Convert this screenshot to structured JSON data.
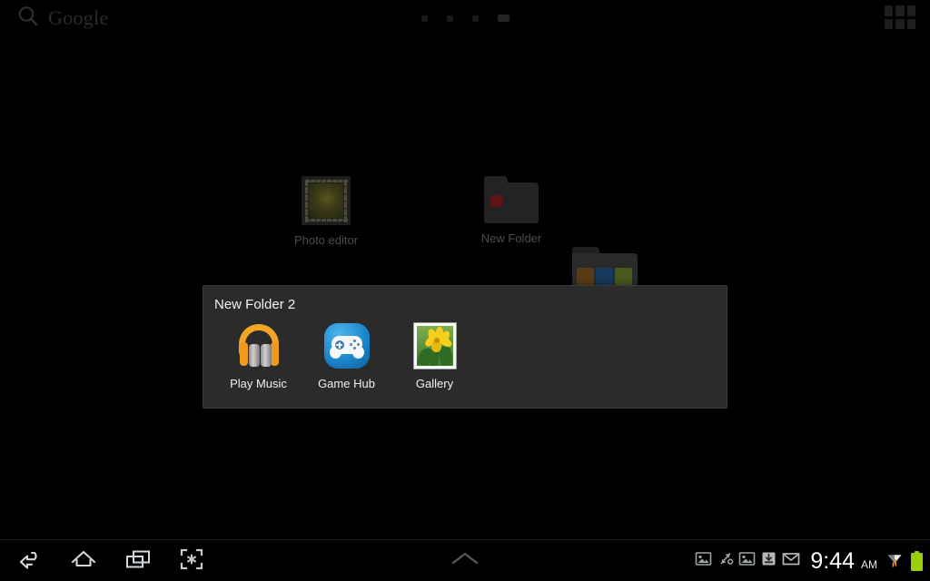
{
  "topbar": {
    "search": {
      "icon": "search-icon",
      "brand": "Google"
    },
    "page_indicator": {
      "count": 4,
      "active_index": 3
    },
    "apps_grid": {
      "icon": "apps-grid-icon",
      "label": "Apps"
    }
  },
  "home_icons": [
    {
      "name": "photo-editor",
      "label": "Photo editor",
      "icon": "photo-frame-icon"
    },
    {
      "name": "new-folder",
      "label": "New Folder",
      "icon": "folder-icon"
    },
    {
      "name": "new-folder-2",
      "label": "",
      "icon": "folder-icon"
    }
  ],
  "folder_dialog": {
    "title": "New Folder 2",
    "apps": [
      {
        "label": "Play Music",
        "icon": "headphones-icon",
        "color": "#f2a423"
      },
      {
        "label": "Game Hub",
        "icon": "game-controller-icon",
        "color": "#1d87cd"
      },
      {
        "label": "Gallery",
        "icon": "photo-flower-icon",
        "color": "#f5cf1b"
      }
    ]
  },
  "navbar": {
    "buttons": [
      {
        "name": "back",
        "icon": "back-arrow-icon"
      },
      {
        "name": "home",
        "icon": "home-icon"
      },
      {
        "name": "recents",
        "icon": "recent-apps-icon"
      },
      {
        "name": "screenshot",
        "icon": "screen-capture-icon"
      }
    ],
    "notification_handle": {
      "icon": "chevron-up-icon"
    }
  },
  "status_tray": {
    "icons": [
      {
        "name": "screenshot-captured",
        "icon": "image-icon"
      },
      {
        "name": "usb-transfer",
        "icon": "usb-transfer-icon"
      },
      {
        "name": "screenshot-saved",
        "icon": "image-icon"
      },
      {
        "name": "download-complete",
        "icon": "download-icon"
      },
      {
        "name": "new-email",
        "icon": "envelope-icon"
      }
    ],
    "clock": {
      "time": "9:44",
      "period": "AM"
    },
    "wifi": {
      "icon": "wifi-icon",
      "activity": true
    },
    "battery": {
      "icon": "battery-icon",
      "color": "#9acd0a"
    }
  },
  "colors": {
    "screen_background": "#000000",
    "dialog_background": "#2b2b2b",
    "dialog_border": "#3b3b3b",
    "dialog_text": "#f2f2f2",
    "dimmed_label": "#4d4d4d",
    "status_bar_divider": "#16232e"
  }
}
